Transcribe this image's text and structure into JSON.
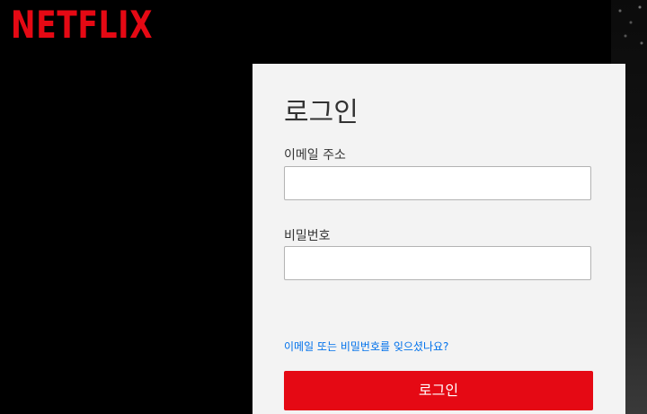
{
  "header": {
    "logo_text": "NETFLIX"
  },
  "login_form": {
    "title": "로그인",
    "email_label": "이메일 주소",
    "email_value": "",
    "password_label": "비밀번호",
    "password_value": "",
    "forgot_link": "이메일 또는 비밀번호를 잊으셨나요?",
    "submit_label": "로그인"
  },
  "colors": {
    "brand_red": "#e50914",
    "link_blue": "#0071eb",
    "card_background": "#f3f3f3",
    "page_background": "#000000"
  }
}
